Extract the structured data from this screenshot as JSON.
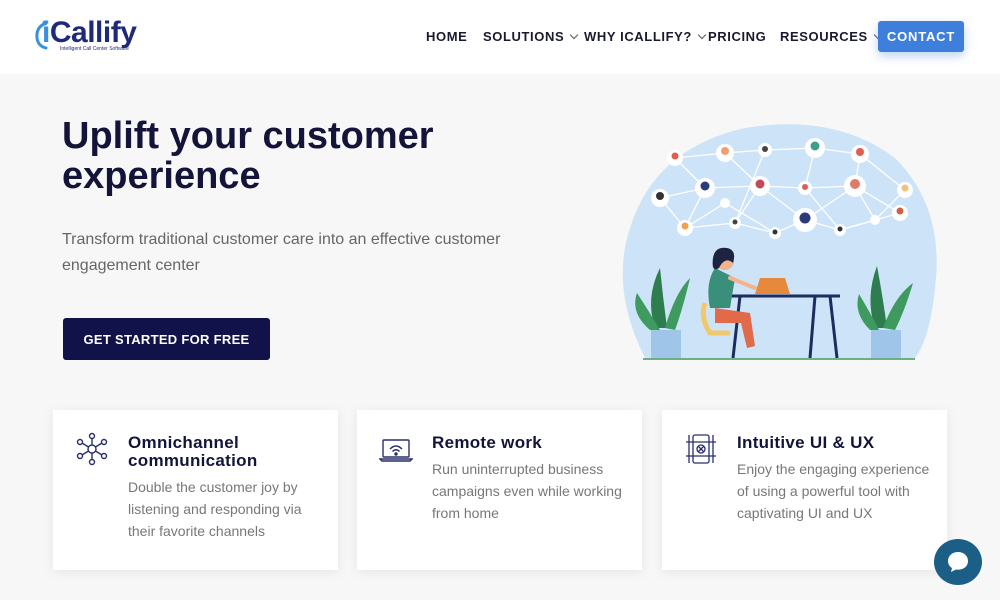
{
  "brand": {
    "name_i": "i",
    "name_rest": "Callify",
    "tagline": "Intelligent Call Center Software"
  },
  "nav": {
    "items": [
      {
        "label": "HOME",
        "has_dropdown": false
      },
      {
        "label": "SOLUTIONS",
        "has_dropdown": true
      },
      {
        "label": "WHY ICALLIFY?",
        "has_dropdown": true
      },
      {
        "label": "PRICING",
        "has_dropdown": false
      },
      {
        "label": "RESOURCES",
        "has_dropdown": true
      }
    ],
    "contact_label": "CONTACT"
  },
  "hero": {
    "title": "Uplift your customer experience",
    "subtitle": "Transform traditional customer care into an effective customer engagement center",
    "cta_label": "GET STARTED FOR FREE"
  },
  "features": [
    {
      "icon": "network-icon",
      "title": "Omnichannel communication",
      "text": "Double the customer joy by listening and responding via their favorite channels"
    },
    {
      "icon": "laptop-wifi-icon",
      "title": "Remote work",
      "text": "Run uninterrupted business campaigns even while working from home"
    },
    {
      "icon": "ui-ux-icon",
      "title": "Intuitive UI & UX",
      "text": "Enjoy the engaging experience of using a powerful tool with captivating UI and UX"
    }
  ],
  "colors": {
    "primary_blue": "#3e7fdc",
    "navy": "#12124a",
    "chat_teal": "#1b5f86",
    "illustration_bg": "#cde3f7"
  },
  "chat": {
    "icon": "chat-bubble-icon"
  }
}
